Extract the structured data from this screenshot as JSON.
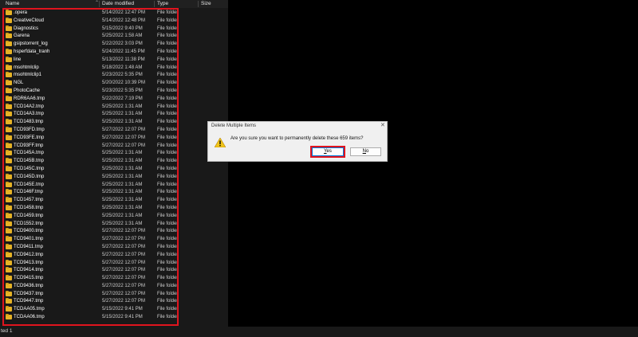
{
  "columns": {
    "name": "Name",
    "date": "Date modified",
    "type": "Type",
    "size": "Size"
  },
  "files": [
    {
      "name": ".opera",
      "date": "5/14/2022 12:47 PM",
      "type": "File folder"
    },
    {
      "name": "CreativeCloud",
      "date": "5/14/2022 12:48 PM",
      "type": "File folder"
    },
    {
      "name": "Diagnostics",
      "date": "5/15/2022 9:40 PM",
      "type": "File folder"
    },
    {
      "name": "Garena",
      "date": "5/25/2022 1:58 AM",
      "type": "File folder"
    },
    {
      "name": "gsipstorrent_log",
      "date": "5/22/2022 3:03 PM",
      "type": "File folder"
    },
    {
      "name": "hsperfdata_tranh",
      "date": "5/24/2022 11:45 PM",
      "type": "File folder"
    },
    {
      "name": "line",
      "date": "5/13/2022 11:38 PM",
      "type": "File folder"
    },
    {
      "name": "msohtmlclip",
      "date": "5/18/2022 1:48 AM",
      "type": "File folder"
    },
    {
      "name": "msohtmlclip1",
      "date": "5/23/2022 5:35 PM",
      "type": "File folder"
    },
    {
      "name": "NGL",
      "date": "5/20/2022 10:39 PM",
      "type": "File folder"
    },
    {
      "name": "PhotoCache",
      "date": "5/23/2022 5:35 PM",
      "type": "File folder"
    },
    {
      "name": "RDR6AA6.tmp",
      "date": "5/22/2022 7:19 PM",
      "type": "File folder"
    },
    {
      "name": "TCD14A2.tmp",
      "date": "5/25/2022 1:31 AM",
      "type": "File folder"
    },
    {
      "name": "TCD14A3.tmp",
      "date": "5/25/2022 1:31 AM",
      "type": "File folder"
    },
    {
      "name": "TCD1483.tmp",
      "date": "5/25/2022 1:31 AM",
      "type": "File folder"
    },
    {
      "name": "TCD93FD.tmp",
      "date": "5/27/2022 12:07 PM",
      "type": "File folder"
    },
    {
      "name": "TCD93FE.tmp",
      "date": "5/27/2022 12:07 PM",
      "type": "File folder"
    },
    {
      "name": "TCD93FF.tmp",
      "date": "5/27/2022 12:07 PM",
      "type": "File folder"
    },
    {
      "name": "TCD145A.tmp",
      "date": "5/25/2022 1:31 AM",
      "type": "File folder"
    },
    {
      "name": "TCD145B.tmp",
      "date": "5/25/2022 1:31 AM",
      "type": "File folder"
    },
    {
      "name": "TCD145C.tmp",
      "date": "5/25/2022 1:31 AM",
      "type": "File folder"
    },
    {
      "name": "TCD145D.tmp",
      "date": "5/25/2022 1:31 AM",
      "type": "File folder"
    },
    {
      "name": "TCD145E.tmp",
      "date": "5/25/2022 1:31 AM",
      "type": "File folder"
    },
    {
      "name": "TCD146F.tmp",
      "date": "5/25/2022 1:31 AM",
      "type": "File folder"
    },
    {
      "name": "TCD1457.tmp",
      "date": "5/25/2022 1:31 AM",
      "type": "File folder"
    },
    {
      "name": "TCD1458.tmp",
      "date": "5/25/2022 1:31 AM",
      "type": "File folder"
    },
    {
      "name": "TCD1459.tmp",
      "date": "5/25/2022 1:31 AM",
      "type": "File folder"
    },
    {
      "name": "TCD1552.tmp",
      "date": "5/25/2022 1:31 AM",
      "type": "File folder"
    },
    {
      "name": "TCD9400.tmp",
      "date": "5/27/2022 12:07 PM",
      "type": "File folder"
    },
    {
      "name": "TCD9401.tmp",
      "date": "5/27/2022 12:07 PM",
      "type": "File folder"
    },
    {
      "name": "TCD9411.tmp",
      "date": "5/27/2022 12:07 PM",
      "type": "File folder"
    },
    {
      "name": "TCD9412.tmp",
      "date": "5/27/2022 12:07 PM",
      "type": "File folder"
    },
    {
      "name": "TCD9413.tmp",
      "date": "5/27/2022 12:07 PM",
      "type": "File folder"
    },
    {
      "name": "TCD9414.tmp",
      "date": "5/27/2022 12:07 PM",
      "type": "File folder"
    },
    {
      "name": "TCD9415.tmp",
      "date": "5/27/2022 12:07 PM",
      "type": "File folder"
    },
    {
      "name": "TCD9436.tmp",
      "date": "5/27/2022 12:07 PM",
      "type": "File folder"
    },
    {
      "name": "TCD9437.tmp",
      "date": "5/27/2022 12:07 PM",
      "type": "File folder"
    },
    {
      "name": "TCD9447.tmp",
      "date": "5/27/2022 12:07 PM",
      "type": "File folder"
    },
    {
      "name": "TCDAA05.tmp",
      "date": "5/15/2022 9:41 PM",
      "type": "File folder"
    },
    {
      "name": "TCDAA06.tmp",
      "date": "5/15/2022 9:41 PM",
      "type": "File folder"
    }
  ],
  "status": {
    "text": "ted  1"
  },
  "dialog": {
    "title": "Delete Multiple Items",
    "close": "✕",
    "message": "Are you sure you want to permanently delete these 659 items?",
    "yes_label_u": "Y",
    "yes_label_rest": "es",
    "no_label_u": "N",
    "no_label_rest": "o"
  },
  "colors": {
    "highlight": "#e0141e",
    "folder": "#e6b325"
  }
}
